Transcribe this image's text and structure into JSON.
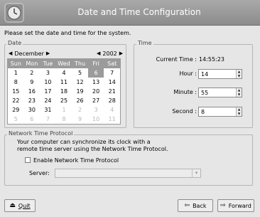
{
  "window": {
    "title": "Date and Time Configuration",
    "logo_icon": "clock-icon"
  },
  "intro": "Please set the date and time for the system.",
  "date": {
    "frame_label": "Date",
    "month": "December",
    "year": "2002",
    "weekdays": [
      "Sun",
      "Mon",
      "Tue",
      "Wed",
      "Thu",
      "Fri",
      "Sat"
    ],
    "weeks": [
      [
        "1",
        "2",
        "3",
        "4",
        "5",
        "6",
        "7"
      ],
      [
        "8",
        "9",
        "10",
        "11",
        "12",
        "13",
        "14"
      ],
      [
        "15",
        "16",
        "17",
        "18",
        "19",
        "20",
        "21"
      ],
      [
        "22",
        "23",
        "24",
        "25",
        "26",
        "27",
        "28"
      ],
      [
        "29",
        "30",
        "31",
        "1",
        "2",
        "3",
        "4"
      ],
      [
        "5",
        "6",
        "7",
        "8",
        "9",
        "10",
        "11"
      ]
    ],
    "selected_day": "6"
  },
  "time": {
    "frame_label": "Time",
    "current_label": "Current Time :",
    "current_value": "14:55:23",
    "hour_label": "Hour :",
    "hour_value": "14",
    "minute_label": "Minute :",
    "minute_value": "55",
    "second_label": "Second :",
    "second_value": "8"
  },
  "ntp": {
    "frame_label": "Network Time Protocol",
    "description_line1": "Your computer can synchronize its clock with a",
    "description_line2": "remote time server using the Network Time Protocol.",
    "enable_label": "Enable Network Time Protocol",
    "enable_checked": false,
    "server_label": "Server:",
    "server_value": ""
  },
  "buttons": {
    "quit": "Quit",
    "back": "Back",
    "forward": "Forward"
  }
}
